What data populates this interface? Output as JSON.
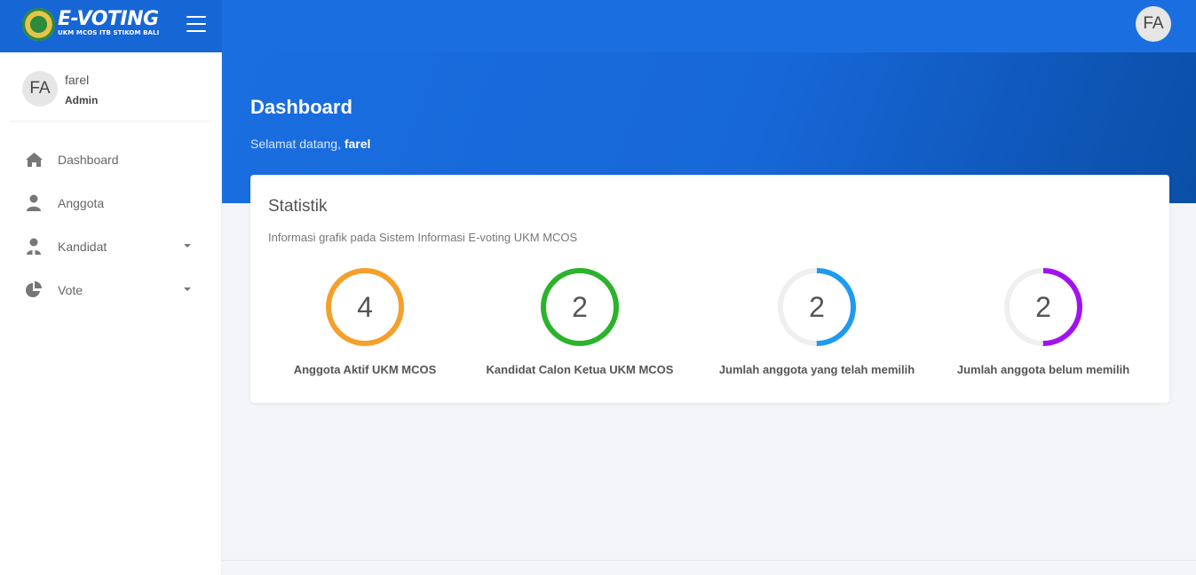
{
  "brand": {
    "title": "E-VOTING",
    "subtitle": "UKM MCOS ITB STIKOM BALI"
  },
  "header": {
    "avatar_initials": "FA"
  },
  "user": {
    "initials": "FA",
    "name": "farel",
    "role": "Admin"
  },
  "sidebar": {
    "items": [
      {
        "label": "Dashboard",
        "icon": "home-icon"
      },
      {
        "label": "Anggota",
        "icon": "user-icon"
      },
      {
        "label": "Kandidat",
        "icon": "candidate-icon",
        "has_submenu": true
      },
      {
        "label": "Vote",
        "icon": "pie-chart-icon",
        "has_submenu": true
      }
    ]
  },
  "page": {
    "title": "Dashboard",
    "welcome_prefix": "Selamat datang, ",
    "welcome_name": "farel"
  },
  "stats_card": {
    "title": "Statistik",
    "subtitle": "Informasi grafik pada Sistem Informasi E-voting UKM MCOS",
    "stats": [
      {
        "value": "4",
        "label": "Anggota Aktif UKM MCOS",
        "color": "#f5a02a",
        "fill": 1.0
      },
      {
        "value": "2",
        "label": "Kandidat Calon Ketua UKM MCOS",
        "color": "#2bb32b",
        "fill": 1.0
      },
      {
        "value": "2",
        "label": "Jumlah anggota yang telah memilih",
        "color": "#1d9bf0",
        "fill": 0.5
      },
      {
        "value": "2",
        "label": "Jumlah anggota belum memilih",
        "color": "#a012f0",
        "fill": 0.5
      }
    ]
  },
  "colors": {
    "primary": "#1a6ee0",
    "track": "#efefef"
  }
}
